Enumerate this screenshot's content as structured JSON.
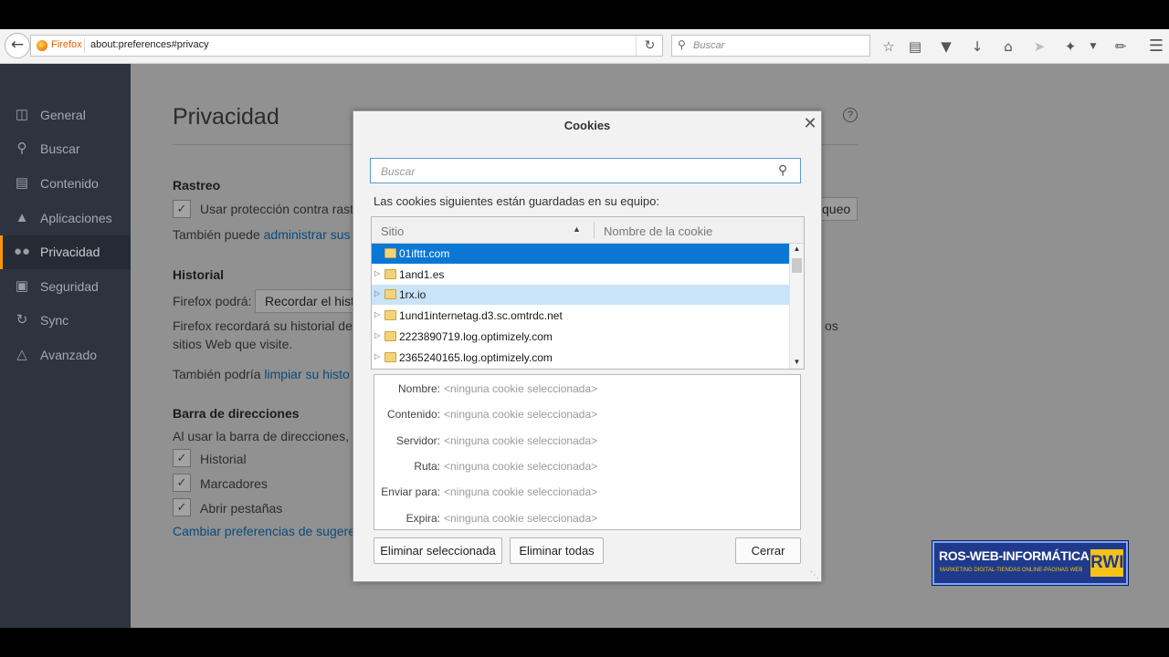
{
  "browser": {
    "identity_label": "Firefox",
    "url": "about:preferences#privacy",
    "search_placeholder": "Buscar"
  },
  "sidebar": {
    "items": [
      {
        "label": "General",
        "icon": "switch-icon"
      },
      {
        "label": "Buscar",
        "icon": "search-icon"
      },
      {
        "label": "Contenido",
        "icon": "document-icon"
      },
      {
        "label": "Aplicaciones",
        "icon": "rocket-icon"
      },
      {
        "label": "Privacidad",
        "icon": "mask-icon",
        "active": true
      },
      {
        "label": "Seguridad",
        "icon": "lock-icon"
      },
      {
        "label": "Sync",
        "icon": "sync-icon"
      },
      {
        "label": "Avanzado",
        "icon": "wizard-icon"
      }
    ]
  },
  "privacy": {
    "title": "Privacidad",
    "tracking": {
      "heading": "Rastreo",
      "checkbox_label": "Usar protección contra rast",
      "manage_prefix": "También puede ",
      "manage_link": "administrar sus",
      "block_button": "queo"
    },
    "history": {
      "heading": "Historial",
      "firefox_will": "Firefox podrá:",
      "select_value": "Recordar el hist",
      "desc_line1": "Firefox recordará su historial de",
      "desc_line1_end": "os",
      "desc_line2": "sitios Web que visite.",
      "clear_prefix": "También podría ",
      "clear_link": "limpiar su histo"
    },
    "addressbar": {
      "heading": "Barra de direcciones",
      "desc": "Al usar la barra de direcciones, s",
      "options": [
        "Historial",
        "Marcadores",
        "Abrir pestañas"
      ],
      "link": "Cambiar preferencias de sugere"
    }
  },
  "dialog": {
    "title": "Cookies",
    "search_placeholder": "Buscar",
    "description": "Las cookies siguientes están guardadas en su equipo:",
    "columns": {
      "site": "Sitio",
      "cookie_name": "Nombre de la cookie"
    },
    "sites": [
      "01ifttt.com",
      "1and1.es",
      "1rx.io",
      "1und1internetag.d3.sc.omtrdc.net",
      "2223890719.log.optimizely.com",
      "2365240165.log.optimizely.com"
    ],
    "selected_index": 0,
    "hover_index": 2,
    "details": [
      {
        "label": "Nombre:",
        "value": "<ninguna cookie seleccionada>"
      },
      {
        "label": "Contenido:",
        "value": "<ninguna cookie seleccionada>"
      },
      {
        "label": "Servidor:",
        "value": "<ninguna cookie seleccionada>"
      },
      {
        "label": "Ruta:",
        "value": "<ninguna cookie seleccionada>"
      },
      {
        "label": "Enviar para:",
        "value": "<ninguna cookie seleccionada>"
      },
      {
        "label": "Expira:",
        "value": "<ninguna cookie seleccionada>"
      }
    ],
    "buttons": {
      "remove_selected": "Eliminar seleccionada",
      "remove_all": "Eliminar todas",
      "close": "Cerrar"
    }
  },
  "watermark": {
    "title": "ROS-WEB-INFORMÁTICA",
    "subtitle": "MARKETING DIGITAL-TIENDAS ONLINE-PÁGINAS WEB",
    "logo": "RWI"
  },
  "colors": {
    "sidebar_bg": "#2e3340",
    "active_accent": "#ff9500",
    "selection_blue": "#0a77d5",
    "hover_blue": "#c9e3f8",
    "link_blue": "#0b4a7c"
  }
}
